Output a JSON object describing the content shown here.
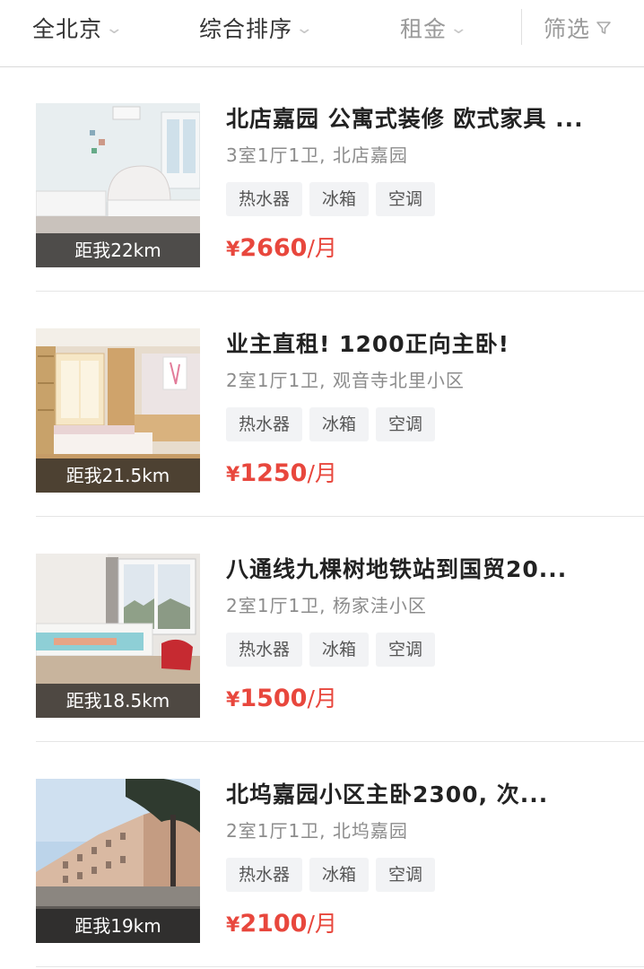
{
  "filters": {
    "city": "全北京",
    "sort": "综合排序",
    "rent": "租金",
    "screen": "筛选"
  },
  "listings": [
    {
      "title": "北店嘉园 公寓式装修 欧式家具 ...",
      "subtitle": "3室1厅1卫, 北店嘉园",
      "tags": [
        "热水器",
        "冰箱",
        "空调"
      ],
      "price": "2660",
      "currency": "¥",
      "unit": "/月",
      "distance": "距我22km"
    },
    {
      "title": "业主直租! 1200正向主卧!",
      "subtitle": "2室1厅1卫, 观音寺北里小区",
      "tags": [
        "热水器",
        "冰箱",
        "空调"
      ],
      "price": "1250",
      "currency": "¥",
      "unit": "/月",
      "distance": "距我21.5km"
    },
    {
      "title": "八通线九棵树地铁站到国贸20...",
      "subtitle": "2室1厅1卫, 杨家洼小区",
      "tags": [
        "热水器",
        "冰箱",
        "空调"
      ],
      "price": "1500",
      "currency": "¥",
      "unit": "/月",
      "distance": "距我18.5km"
    },
    {
      "title": "北坞嘉园小区主卧2300, 次...",
      "subtitle": "2室1厅1卫, 北坞嘉园",
      "tags": [
        "热水器",
        "冰箱",
        "空调"
      ],
      "price": "2100",
      "currency": "¥",
      "unit": "/月",
      "distance": "距我19km"
    }
  ],
  "colors": {
    "price": "#e8473d",
    "tag_bg": "#f2f3f5",
    "distance_overlay": "#1e1e1e"
  }
}
